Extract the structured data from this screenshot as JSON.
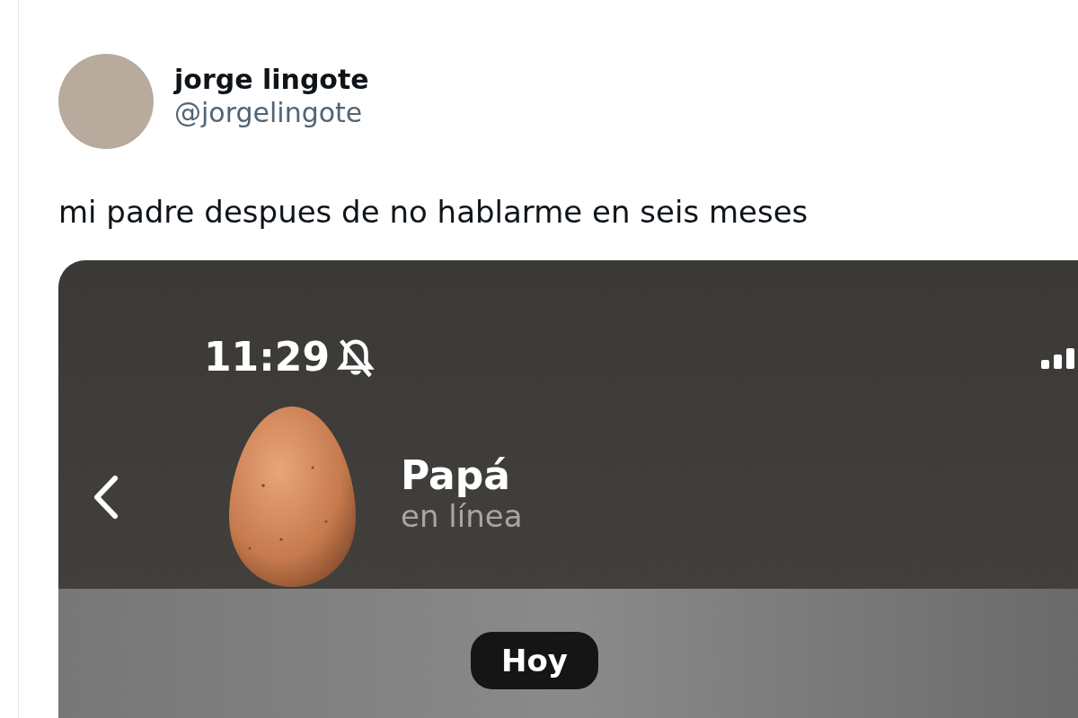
{
  "tweet": {
    "author": {
      "name": "jorge lingote",
      "handle": "@jorgelingote"
    },
    "text": "mi padre despues de no hablarme en seis meses",
    "media": {
      "status_bar": {
        "time": "11:29"
      },
      "chat_header": {
        "name": "Papá",
        "status": "en línea"
      },
      "date_chip": "Hoy"
    }
  }
}
